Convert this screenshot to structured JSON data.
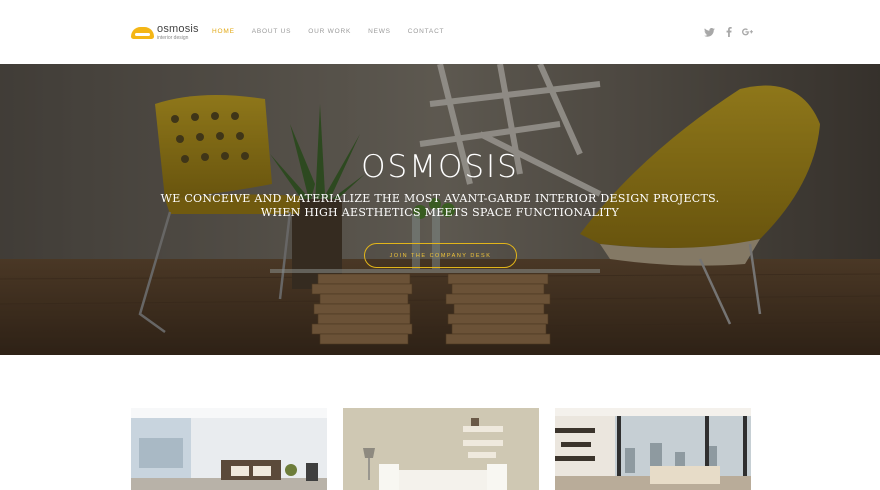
{
  "brand": {
    "name": "osmosis",
    "subtitle": "interior design",
    "accent_color": "#e2a916"
  },
  "nav": {
    "items": [
      {
        "label": "HOME",
        "active": true
      },
      {
        "label": "ABOUT US",
        "active": false
      },
      {
        "label": "OUR WORK",
        "active": false
      },
      {
        "label": "NEWS",
        "active": false
      },
      {
        "label": "CONTACT",
        "active": false
      }
    ]
  },
  "social": {
    "icons": [
      "twitter-icon",
      "facebook-icon",
      "google-plus-icon"
    ],
    "icon_color": "#a8a8a8"
  },
  "hero": {
    "title": "OSMOSIS",
    "tagline_line1": "WE CONCEIVE AND MATERIALIZE THE MOST AVANT-GARDE INTERIOR DESIGN PROJECTS.",
    "tagline_line2": "WHEN HIGH AESTHETICS MEETS SPACE FUNCTIONALITY",
    "button_label": "JOIN THE COMPANY DESK",
    "button_color": "#e2b51a"
  },
  "gallery": {
    "thumbnails": [
      "interior-photo-living-room-window",
      "interior-photo-white-sofa-shelves",
      "interior-photo-city-view-lounge"
    ]
  }
}
